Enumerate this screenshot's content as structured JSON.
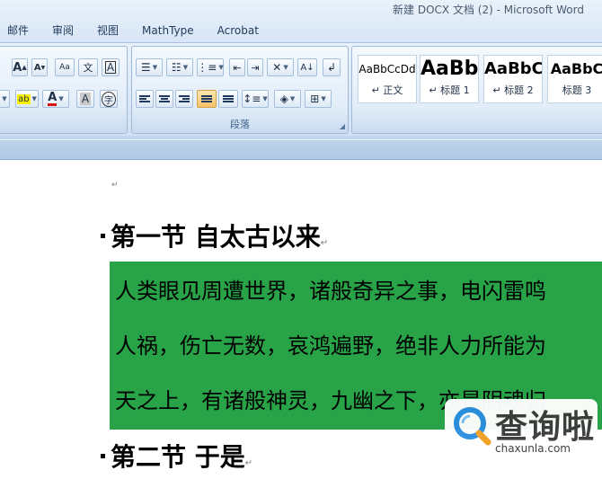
{
  "window": {
    "title": "新建 DOCX 文档 (2) - Microsoft Word"
  },
  "tabs": [
    "邮件",
    "审阅",
    "视图",
    "MathType",
    "Acrobat"
  ],
  "ribbon": {
    "paragraph_group_label": "段落",
    "styles": [
      {
        "sample": "AaBbCcDd",
        "name": "↵ 正文"
      },
      {
        "sample": "AaBb",
        "name": "↵ 标题 1"
      },
      {
        "sample": "AaBbC",
        "name": "↵ 标题 2"
      },
      {
        "sample": "AaBbC",
        "name": "标题 3"
      }
    ]
  },
  "document": {
    "heading1": "第一节  自太古以来",
    "paragraph_lines": [
      "人类眼见周遭世界，诸般奇异之事，电闪雷鸣",
      "人祸，伤亡无数，哀鸿遍野，绝非人力所能为",
      "天之上，有诸般神灵，九幽之下，亦是阴魂归"
    ],
    "heading2": "第二节  于是",
    "paragraph_mark": "↵",
    "highlight_color": "#28a347"
  },
  "watermark": {
    "name": "查询啦",
    "url": "chaxunla.com"
  }
}
